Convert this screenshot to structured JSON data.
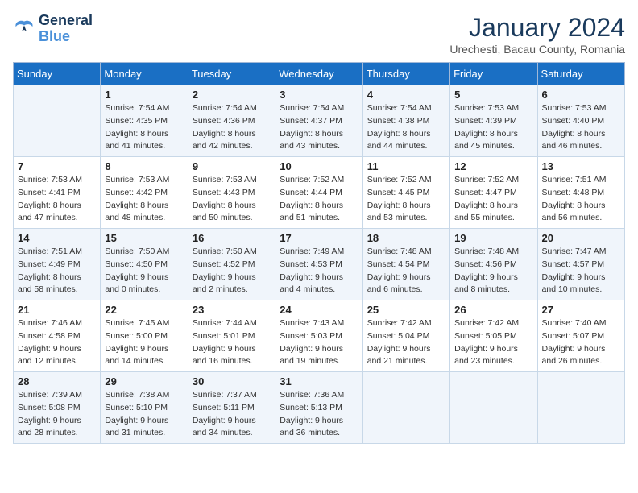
{
  "logo": {
    "line1": "General",
    "line2": "Blue"
  },
  "title": "January 2024",
  "location": "Urechesti, Bacau County, Romania",
  "weekdays": [
    "Sunday",
    "Monday",
    "Tuesday",
    "Wednesday",
    "Thursday",
    "Friday",
    "Saturday"
  ],
  "weeks": [
    [
      {
        "day": "",
        "sunrise": "",
        "sunset": "",
        "daylight": ""
      },
      {
        "day": "1",
        "sunrise": "Sunrise: 7:54 AM",
        "sunset": "Sunset: 4:35 PM",
        "daylight": "Daylight: 8 hours and 41 minutes."
      },
      {
        "day": "2",
        "sunrise": "Sunrise: 7:54 AM",
        "sunset": "Sunset: 4:36 PM",
        "daylight": "Daylight: 8 hours and 42 minutes."
      },
      {
        "day": "3",
        "sunrise": "Sunrise: 7:54 AM",
        "sunset": "Sunset: 4:37 PM",
        "daylight": "Daylight: 8 hours and 43 minutes."
      },
      {
        "day": "4",
        "sunrise": "Sunrise: 7:54 AM",
        "sunset": "Sunset: 4:38 PM",
        "daylight": "Daylight: 8 hours and 44 minutes."
      },
      {
        "day": "5",
        "sunrise": "Sunrise: 7:53 AM",
        "sunset": "Sunset: 4:39 PM",
        "daylight": "Daylight: 8 hours and 45 minutes."
      },
      {
        "day": "6",
        "sunrise": "Sunrise: 7:53 AM",
        "sunset": "Sunset: 4:40 PM",
        "daylight": "Daylight: 8 hours and 46 minutes."
      }
    ],
    [
      {
        "day": "7",
        "sunrise": "Sunrise: 7:53 AM",
        "sunset": "Sunset: 4:41 PM",
        "daylight": "Daylight: 8 hours and 47 minutes."
      },
      {
        "day": "8",
        "sunrise": "Sunrise: 7:53 AM",
        "sunset": "Sunset: 4:42 PM",
        "daylight": "Daylight: 8 hours and 48 minutes."
      },
      {
        "day": "9",
        "sunrise": "Sunrise: 7:53 AM",
        "sunset": "Sunset: 4:43 PM",
        "daylight": "Daylight: 8 hours and 50 minutes."
      },
      {
        "day": "10",
        "sunrise": "Sunrise: 7:52 AM",
        "sunset": "Sunset: 4:44 PM",
        "daylight": "Daylight: 8 hours and 51 minutes."
      },
      {
        "day": "11",
        "sunrise": "Sunrise: 7:52 AM",
        "sunset": "Sunset: 4:45 PM",
        "daylight": "Daylight: 8 hours and 53 minutes."
      },
      {
        "day": "12",
        "sunrise": "Sunrise: 7:52 AM",
        "sunset": "Sunset: 4:47 PM",
        "daylight": "Daylight: 8 hours and 55 minutes."
      },
      {
        "day": "13",
        "sunrise": "Sunrise: 7:51 AM",
        "sunset": "Sunset: 4:48 PM",
        "daylight": "Daylight: 8 hours and 56 minutes."
      }
    ],
    [
      {
        "day": "14",
        "sunrise": "Sunrise: 7:51 AM",
        "sunset": "Sunset: 4:49 PM",
        "daylight": "Daylight: 8 hours and 58 minutes."
      },
      {
        "day": "15",
        "sunrise": "Sunrise: 7:50 AM",
        "sunset": "Sunset: 4:50 PM",
        "daylight": "Daylight: 9 hours and 0 minutes."
      },
      {
        "day": "16",
        "sunrise": "Sunrise: 7:50 AM",
        "sunset": "Sunset: 4:52 PM",
        "daylight": "Daylight: 9 hours and 2 minutes."
      },
      {
        "day": "17",
        "sunrise": "Sunrise: 7:49 AM",
        "sunset": "Sunset: 4:53 PM",
        "daylight": "Daylight: 9 hours and 4 minutes."
      },
      {
        "day": "18",
        "sunrise": "Sunrise: 7:48 AM",
        "sunset": "Sunset: 4:54 PM",
        "daylight": "Daylight: 9 hours and 6 minutes."
      },
      {
        "day": "19",
        "sunrise": "Sunrise: 7:48 AM",
        "sunset": "Sunset: 4:56 PM",
        "daylight": "Daylight: 9 hours and 8 minutes."
      },
      {
        "day": "20",
        "sunrise": "Sunrise: 7:47 AM",
        "sunset": "Sunset: 4:57 PM",
        "daylight": "Daylight: 9 hours and 10 minutes."
      }
    ],
    [
      {
        "day": "21",
        "sunrise": "Sunrise: 7:46 AM",
        "sunset": "Sunset: 4:58 PM",
        "daylight": "Daylight: 9 hours and 12 minutes."
      },
      {
        "day": "22",
        "sunrise": "Sunrise: 7:45 AM",
        "sunset": "Sunset: 5:00 PM",
        "daylight": "Daylight: 9 hours and 14 minutes."
      },
      {
        "day": "23",
        "sunrise": "Sunrise: 7:44 AM",
        "sunset": "Sunset: 5:01 PM",
        "daylight": "Daylight: 9 hours and 16 minutes."
      },
      {
        "day": "24",
        "sunrise": "Sunrise: 7:43 AM",
        "sunset": "Sunset: 5:03 PM",
        "daylight": "Daylight: 9 hours and 19 minutes."
      },
      {
        "day": "25",
        "sunrise": "Sunrise: 7:42 AM",
        "sunset": "Sunset: 5:04 PM",
        "daylight": "Daylight: 9 hours and 21 minutes."
      },
      {
        "day": "26",
        "sunrise": "Sunrise: 7:42 AM",
        "sunset": "Sunset: 5:05 PM",
        "daylight": "Daylight: 9 hours and 23 minutes."
      },
      {
        "day": "27",
        "sunrise": "Sunrise: 7:40 AM",
        "sunset": "Sunset: 5:07 PM",
        "daylight": "Daylight: 9 hours and 26 minutes."
      }
    ],
    [
      {
        "day": "28",
        "sunrise": "Sunrise: 7:39 AM",
        "sunset": "Sunset: 5:08 PM",
        "daylight": "Daylight: 9 hours and 28 minutes."
      },
      {
        "day": "29",
        "sunrise": "Sunrise: 7:38 AM",
        "sunset": "Sunset: 5:10 PM",
        "daylight": "Daylight: 9 hours and 31 minutes."
      },
      {
        "day": "30",
        "sunrise": "Sunrise: 7:37 AM",
        "sunset": "Sunset: 5:11 PM",
        "daylight": "Daylight: 9 hours and 34 minutes."
      },
      {
        "day": "31",
        "sunrise": "Sunrise: 7:36 AM",
        "sunset": "Sunset: 5:13 PM",
        "daylight": "Daylight: 9 hours and 36 minutes."
      },
      {
        "day": "",
        "sunrise": "",
        "sunset": "",
        "daylight": ""
      },
      {
        "day": "",
        "sunrise": "",
        "sunset": "",
        "daylight": ""
      },
      {
        "day": "",
        "sunrise": "",
        "sunset": "",
        "daylight": ""
      }
    ]
  ]
}
